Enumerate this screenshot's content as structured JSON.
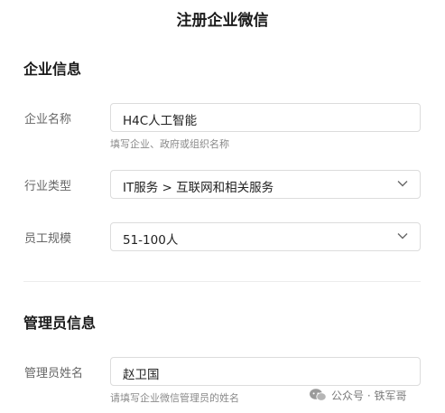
{
  "page": {
    "title": "注册企业微信"
  },
  "company_section": {
    "title": "企业信息",
    "name": {
      "label": "企业名称",
      "value": "H4C人工智能",
      "hint": "填写企业、政府或组织名称"
    },
    "industry": {
      "label": "行业类型",
      "value": "IT服务 > 互联网和相关服务"
    },
    "size": {
      "label": "员工规模",
      "value": "51-100人"
    }
  },
  "admin_section": {
    "title": "管理员信息",
    "name": {
      "label": "管理员姓名",
      "value": "赵卫国",
      "hint": "请填写企业微信管理员的姓名"
    }
  },
  "watermark": {
    "text": "公众号 · 铁军哥",
    "icon": "wechat-official-account-icon"
  },
  "colors": {
    "border": "#dcdcdc",
    "label": "#666666",
    "hint": "#8a8a8a",
    "divider": "#ececec"
  }
}
